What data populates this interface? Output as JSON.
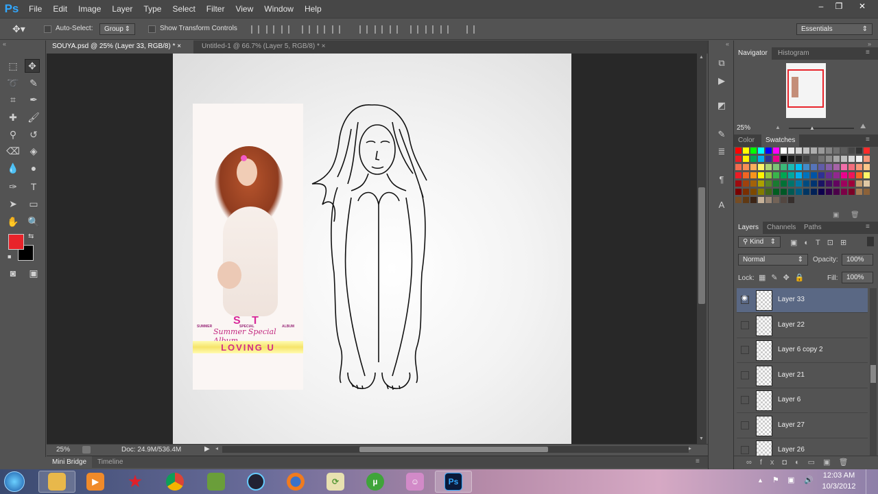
{
  "app": {
    "logo": "Ps"
  },
  "menu": [
    "File",
    "Edit",
    "Image",
    "Layer",
    "Type",
    "Select",
    "Filter",
    "View",
    "Window",
    "Help"
  ],
  "window_controls": [
    "–",
    "❐",
    "✕"
  ],
  "options": {
    "auto_select_label": "Auto-Select:",
    "auto_select_value": "Group",
    "transform_label": "Show Transform Controls",
    "workspace": "Essentials"
  },
  "tabs": [
    {
      "label": "SOUYA.psd @ 25% (Layer 33, RGB/8) *",
      "close": "×"
    },
    {
      "label": "Untitled-1 @ 66.7% (Layer 5, RGB/8) *",
      "close": "×"
    }
  ],
  "album": {
    "top_letters": "S  T",
    "labels": [
      "SUMMER",
      "SPECIAL",
      "ALBUM"
    ],
    "script_title": "Summer Special Album",
    "title": "LOVING U"
  },
  "status": {
    "zoom": "25%",
    "doc": "Doc: 24.9M/536.4M"
  },
  "bottom_tabs": [
    "Mini Bridge",
    "Timeline"
  ],
  "navigator": {
    "tabs": [
      "Navigator",
      "Histogram"
    ],
    "zoom": "25%"
  },
  "color_panel": {
    "tabs": [
      "Color",
      "Swatches"
    ]
  },
  "layers_panel": {
    "tabs": [
      "Layers",
      "Channels",
      "Paths"
    ],
    "kind_label": "Kind",
    "blend_mode": "Normal",
    "opacity_label": "Opacity:",
    "opacity_value": "100%",
    "lock_label": "Lock:",
    "fill_label": "Fill:",
    "fill_value": "100%",
    "layers": [
      {
        "name": "Layer 33",
        "visible": true,
        "selected": true
      },
      {
        "name": "Layer 22",
        "visible": false,
        "selected": false
      },
      {
        "name": "Layer 6 copy 2",
        "visible": false,
        "selected": false
      },
      {
        "name": "Layer 21",
        "visible": false,
        "selected": false
      },
      {
        "name": "Layer 6",
        "visible": false,
        "selected": false
      },
      {
        "name": "Layer 27",
        "visible": false,
        "selected": false
      },
      {
        "name": "Layer 26",
        "visible": false,
        "selected": false
      }
    ]
  },
  "taskbar": {
    "time": "12:03 AM",
    "date": "10/3/2012",
    "ps_label": "Ps"
  },
  "colors": {
    "foreground": "#e8232a",
    "background": "#000000",
    "accent": "#31a8ff"
  }
}
